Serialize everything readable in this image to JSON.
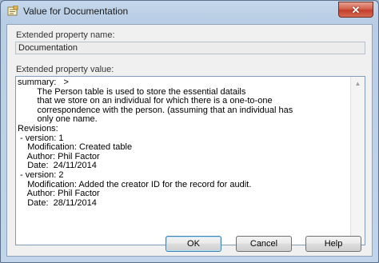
{
  "window": {
    "title": "Value for Documentation",
    "close_label": "✕"
  },
  "form": {
    "name_label": "Extended property name:",
    "name_value": "Documentation",
    "value_label": "Extended property value:",
    "value_lines": [
      "summary:   >",
      "        The Person table is used to store the essential datails",
      "        that we store on an individual for which there is a one-to-one",
      "        correspondence with the person. (assuming that an individual has",
      "        only one name.",
      "Revisions:",
      " - version: 1",
      "    Modification: Created table",
      "    Author: Phil Factor",
      "    Date:  24/11/2014",
      " - version: 2",
      "    Modification: Added the creator ID for the record for audit.",
      "    Author: Phil Factor",
      "    Date:  28/11/2014"
    ]
  },
  "buttons": {
    "ok": "OK",
    "cancel": "Cancel",
    "help": "Help"
  },
  "icons": {
    "app": "properties-icon",
    "scroll_up": "▲",
    "scroll_down": "▼"
  }
}
